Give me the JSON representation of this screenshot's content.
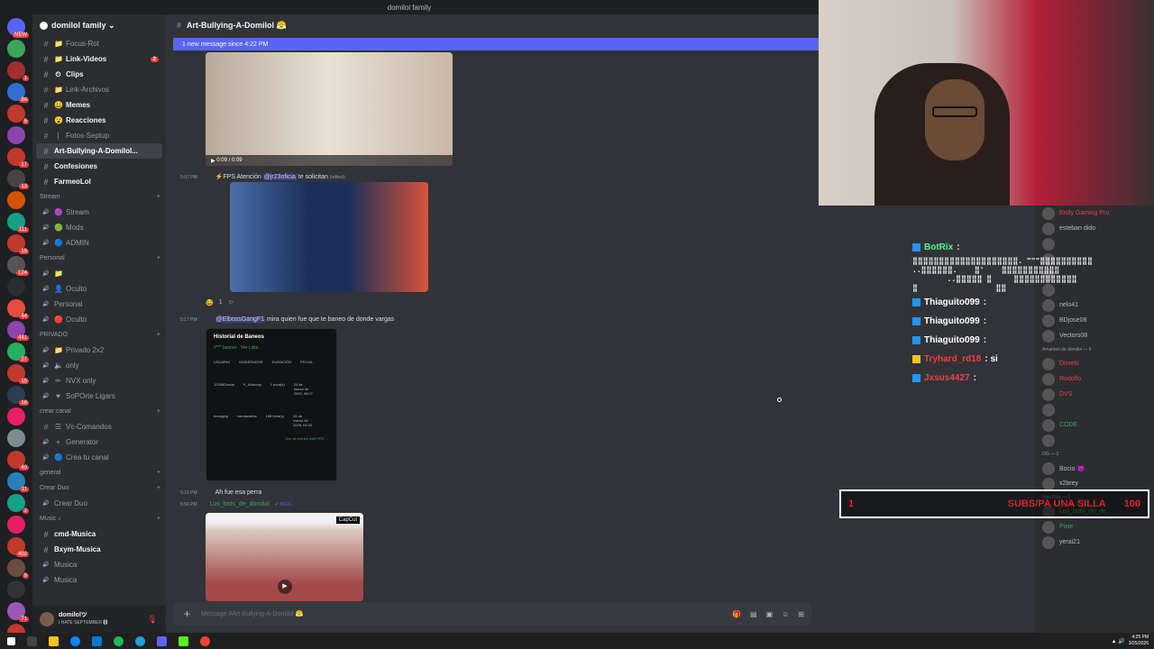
{
  "window": {
    "title": "domilol family"
  },
  "servers": [
    {
      "color": "#5865f2",
      "badge": "NEW"
    },
    {
      "color": "#3ba55c",
      "badge": ""
    },
    {
      "color": "#a12d2d",
      "badge": "1"
    },
    {
      "color": "#2e6fd1",
      "badge": "84"
    },
    {
      "color": "#c0392b",
      "badge": "5"
    },
    {
      "color": "#8e44ad",
      "badge": ""
    },
    {
      "color": "#c0392b",
      "badge": "17"
    },
    {
      "color": "#444",
      "badge": "13"
    },
    {
      "color": "#d35400",
      "badge": ""
    },
    {
      "color": "#16a085",
      "badge": "111"
    },
    {
      "color": "#c0392b",
      "badge": "15"
    },
    {
      "color": "#555",
      "badge": "124"
    },
    {
      "color": "#2b2d31",
      "badge": ""
    },
    {
      "color": "#e74c3c",
      "badge": "44"
    },
    {
      "color": "#8e44ad",
      "badge": "441"
    },
    {
      "color": "#27ae60",
      "badge": "27"
    },
    {
      "color": "#c0392b",
      "badge": "15"
    },
    {
      "color": "#2c3e50",
      "badge": "18"
    },
    {
      "color": "#e91e63",
      "badge": ""
    },
    {
      "color": "#7f8c8d",
      "badge": ""
    },
    {
      "color": "#c0392b",
      "badge": "40"
    },
    {
      "color": "#2980b9",
      "badge": "11"
    },
    {
      "color": "#16a085",
      "badge": "2"
    },
    {
      "color": "#e91e63",
      "badge": ""
    },
    {
      "color": "#c0392b",
      "badge": "402"
    },
    {
      "color": "#6d4c41",
      "badge": "9"
    },
    {
      "color": "#333",
      "badge": ""
    },
    {
      "color": "#9b59b6",
      "badge": "71"
    },
    {
      "color": "#c0392b",
      "badge": "1"
    },
    {
      "color": "#3ba55c",
      "badge": "NEW"
    }
  ],
  "guild": {
    "name": "domilol family ⌄"
  },
  "channels": [
    {
      "type": "ch",
      "icon": "📁",
      "label": "Focus-Rot",
      "bold": false
    },
    {
      "type": "ch",
      "icon": "📁",
      "label": "Link-Videos",
      "bold": true,
      "badge": "2"
    },
    {
      "type": "ch",
      "icon": "⏲",
      "label": "Clips",
      "bold": true
    },
    {
      "type": "ch",
      "icon": "📁",
      "label": "Link-Archivos",
      "bold": false
    },
    {
      "type": "ch",
      "icon": "😀",
      "label": "Memes",
      "bold": true
    },
    {
      "type": "ch",
      "icon": "😮",
      "label": "Reacciones",
      "bold": true
    },
    {
      "type": "ch",
      "icon": "|",
      "label": "Fotos-Septup",
      "bold": false
    },
    {
      "type": "ch",
      "icon": "",
      "label": "Art-Bullying-A-Domilol...",
      "bold": true,
      "selected": true
    },
    {
      "type": "ch",
      "icon": "",
      "label": "Confesiones",
      "bold": true
    },
    {
      "type": "ch",
      "icon": "",
      "label": "FarmeoLol",
      "bold": true
    },
    {
      "type": "cat",
      "label": "Stream"
    },
    {
      "type": "vc",
      "icon": "🟣",
      "label": "Stream"
    },
    {
      "type": "vc",
      "icon": "🟢",
      "label": "Mods"
    },
    {
      "type": "vc",
      "icon": "🔵",
      "label": "ADMIN"
    },
    {
      "type": "cat",
      "label": "Personal"
    },
    {
      "type": "vc",
      "icon": "📁",
      "label": ""
    },
    {
      "type": "vc",
      "icon": "👤",
      "label": "Oculto"
    },
    {
      "type": "vc",
      "icon": "",
      "label": "Personal"
    },
    {
      "type": "vc",
      "icon": "🔴",
      "label": "Oculto"
    },
    {
      "type": "cat",
      "label": "PRIVADO"
    },
    {
      "type": "vc",
      "icon": "📁",
      "label": "Privado 2x2"
    },
    {
      "type": "vc",
      "icon": "🔈",
      "label": "only"
    },
    {
      "type": "vc",
      "icon": "✏",
      "label": "NVX only"
    },
    {
      "type": "vc",
      "icon": "♥",
      "label": "SoPOrte Ligars"
    },
    {
      "type": "cat",
      "label": "crear canal"
    },
    {
      "type": "ch",
      "icon": "☰",
      "label": "Vc-Comandos",
      "bold": false
    },
    {
      "type": "vc",
      "icon": "+",
      "label": "Generator"
    },
    {
      "type": "vc",
      "icon": "🔵",
      "label": "Crea tu canal"
    },
    {
      "type": "cat",
      "label": "general"
    },
    {
      "type": "cat",
      "label": "Crear Duo"
    },
    {
      "type": "vc",
      "icon": "",
      "label": "Crear Duo"
    },
    {
      "type": "cat",
      "label": "Music ♪"
    },
    {
      "type": "ch",
      "icon": "",
      "label": "cmd-Musica",
      "bold": true
    },
    {
      "type": "ch",
      "icon": "",
      "label": "Bxym-Musica",
      "bold": true
    },
    {
      "type": "vc",
      "icon": "",
      "label": "Musica"
    },
    {
      "type": "vc",
      "icon": "",
      "label": "Musica"
    }
  ],
  "user": {
    "name": "domilolツ",
    "status": "I HATE SEPTEMBER 🅱"
  },
  "chat": {
    "channel_name": "Art-Bullying-A-Domilol 😤",
    "new_messages": "1 new message since 4:22 PM",
    "video1_time": "0:09 / 0:09",
    "msg2": {
      "time": "5:07 PM",
      "author": "",
      "text_pre": "⚡FPS  Atención",
      "mention": "@jr23oficia",
      "text_post": "te solicitan",
      "edited": "(edited)"
    },
    "reaction": {
      "emoji": "😂",
      "count": "1"
    },
    "msg3": {
      "time": "5:17 PM",
      "author": "",
      "mention": "@ElbossGangF1",
      "text": "mira quien fue que te baneo de donde vargas"
    },
    "ban": {
      "title": "Historial de Baneos",
      "sub": "#*** banner · Ver Lista",
      "cols": [
        "USUARIO",
        "MODERADOR",
        "DURACIÓN",
        "FECHA"
      ],
      "user1": "12345Garcia",
      "mod1": "K_Ikidoody",
      "dur1": "1 hora(s)",
      "date1": "24 de marzo de 2026, 06:07",
      "user2": "boxsging",
      "mod2": "vandacarlos",
      "dur2": "168 hora(s)",
      "date2": "24 de marzo de 2026, 06:33",
      "link": "See all entries with PRO →"
    },
    "msg4": {
      "time": "5:23 PM",
      "author": "",
      "text": "Ah fue esa perra"
    },
    "msg5": {
      "time": "5:56 PM",
      "author": "Los_bots_de_domilol",
      "badge": "✔ MDZL"
    },
    "capcut": "CapCut",
    "input_placeholder": "Message #Art-Bullying-A-Domilol 😤"
  },
  "stream_chat": [
    {
      "kind": "bot",
      "name": "BotRix",
      "suffix": ":"
    },
    {
      "kind": "ascii",
      "text": "⣿⣿⣿⣿⣿⣿⣿⣿⣿⣿⣿⣿⣿⣿⣿⣿⣿⣿⣿⣿. \"\"\"⣿⣿⣿⣿⣿⣿⣿⣿⣿⣿\n..⣿⣿⣿⣿⣿⣿.    ⣿'    ⣿⣿⣿⣿⣿⣿⣿⣿⣿⣿⣿\n        ..⣿⣿⣿⣿⣿ ⣿     ⣿⣿⣿⣿⣿⣿⣿⣿⣿⣿⣿⣿\n⣿                  ⣿⣿"
    },
    {
      "kind": "user",
      "name": "Thiaguito099",
      "text": ":"
    },
    {
      "kind": "user",
      "name": "Thiaguito099",
      "text": ":"
    },
    {
      "kind": "user",
      "name": "Thiaguito099",
      "text": ":"
    },
    {
      "kind": "red",
      "name": "Tryhard_rd18",
      "text": ": si"
    },
    {
      "kind": "red",
      "name": "Jxsus4427",
      "text": ":"
    }
  ],
  "subs_goal": {
    "left": "1",
    "text": "SUBS/PA UNA SILLA",
    "right": "100"
  },
  "members": {
    "top": [
      {
        "name": "Endy Gaming Pro",
        "cls": "red"
      },
      {
        "name": "esteban dido",
        "sub": "Roblox"
      },
      {
        "name": "",
        "sub": ""
      },
      {
        "name": "",
        "sub": ""
      },
      {
        "name": "",
        "sub": ""
      },
      {
        "name": "",
        "sub": ""
      },
      {
        "name": "nelo41",
        "sub": ""
      },
      {
        "name": "BDjose08",
        "sub": ""
      },
      {
        "name": "Vectors08",
        "sub": ""
      }
    ],
    "cat1": "Amantes de domilol — 6",
    "list1": [
      {
        "name": "Dimelo",
        "cls": "red"
      },
      {
        "name": "Rodolfo",
        "cls": "red"
      },
      {
        "name": "DVS",
        "cls": "red"
      },
      {
        "name": "",
        "cls": "red"
      },
      {
        "name": "CODE",
        "cls": "green"
      },
      {
        "name": "",
        "cls": ""
      }
    ],
    "cat2": "OG — 2",
    "list2": [
      {
        "name": "Bocio 😈",
        "cls": ""
      },
      {
        "name": "x2brey",
        "cls": ""
      }
    ],
    "cat3": "Vips Kick — 3",
    "list3": [
      {
        "name": "Los_bots_de_do...",
        "cls": "green"
      },
      {
        "name": "Pixie",
        "cls": "green",
        "sub": "Grand Theft Auto V"
      },
      {
        "name": "yerai21",
        "cls": ""
      }
    ]
  },
  "taskbar": {
    "time": "4:25 PM",
    "date": "3/25/2026"
  }
}
